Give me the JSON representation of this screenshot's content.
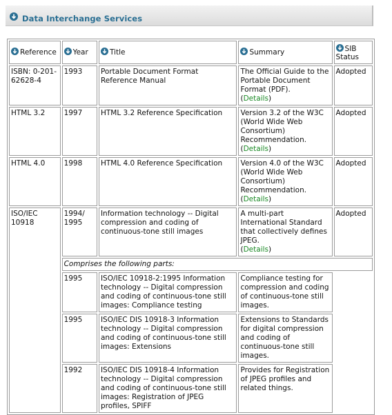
{
  "header": {
    "title": "Data Interchange Services"
  },
  "columns": [
    "Reference",
    "Year",
    "Title",
    "Summary",
    "SIB Status"
  ],
  "rows": [
    {
      "reference": "ISBN: 0-201-62628-4",
      "year": "1993",
      "title": "Portable Document Format Reference Manual",
      "summary": "The Official Guide to the Portable Document Format (PDF).",
      "details": "Details",
      "status": "Adopted"
    },
    {
      "reference": "HTML 3.2",
      "year": "1997",
      "title": "HTML 3.2 Reference Specification",
      "summary": "Version 3.2 of the W3C (World Wide Web Consortium) Recommendation.",
      "details": "Details",
      "status": "Adopted"
    },
    {
      "reference": "HTML 4.0",
      "year": "1998",
      "title": "HTML 4.0 Reference Specification",
      "summary": "Version 4.0 of the W3C (World Wide Web Consortium) Recommendation.",
      "details": "Details",
      "status": "Adopted"
    },
    {
      "reference": "ISO/IEC 10918",
      "year": "1994/ 1995",
      "title": "Information technology -- Digital compression and coding of continuous-tone still images",
      "summary": "A multi-part International Standard that collectively defines JPEG.",
      "details": "Details",
      "status": "Adopted"
    }
  ],
  "parts_label": "Comprises the following parts:",
  "parts": [
    {
      "year": "1995",
      "title": "ISO/IEC 10918-2:1995 Information technology -- Digital compression and coding of continuous-tone still images: Compliance testing",
      "summary": "Compliance testing for compression and coding of continuous-tone still images."
    },
    {
      "year": "1995",
      "title": "ISO/IEC DIS 10918-3 Information technology -- Digital compression and coding of continuous-tone still images: Extensions",
      "summary": "Extensions to Standards for digital compression and coding of continuous-tone still images."
    },
    {
      "year": "1992",
      "title": "ISO/IEC DIS 10918-4 Information technology -- Digital compression and coding of continuous-tone still images: Registration of JPEG profiles, SPIFF",
      "summary": "Provides for Registration of JPEG profiles and related things."
    }
  ],
  "colors": {
    "accent": "#2a6f93",
    "link": "#1b8a26"
  },
  "icons": {
    "header": "circle-down-arrow-icon",
    "sort": "sort-down-arrow-icon"
  }
}
